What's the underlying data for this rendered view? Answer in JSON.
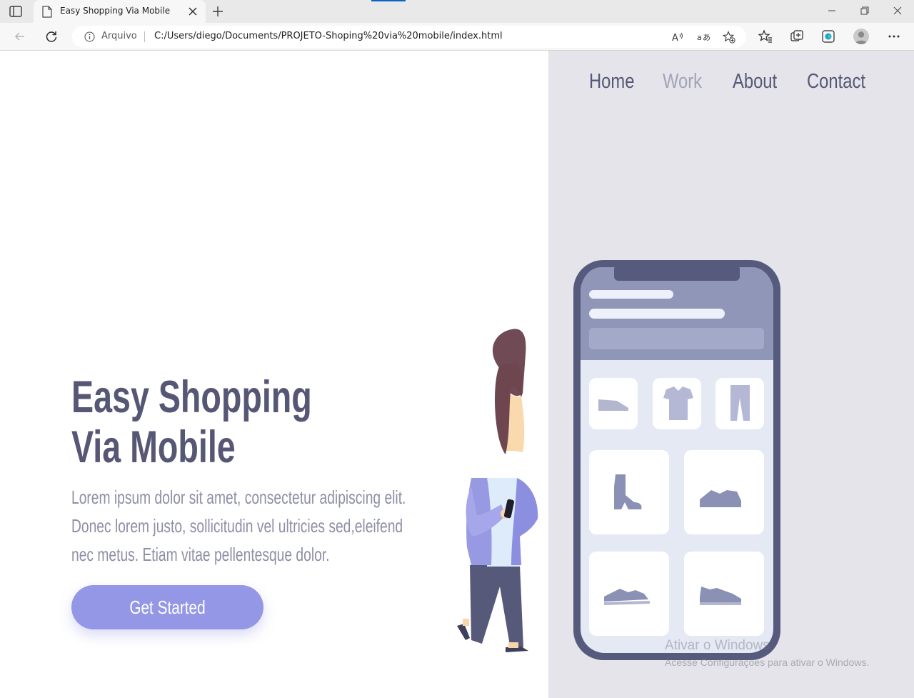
{
  "browser": {
    "tab_title": "Easy Shopping Via Mobile",
    "site_info": "Arquivo",
    "url": "C:/Users/diego/Documents/PROJETO-Shoping%20via%20mobile/index.html",
    "accent_color": "#0a64c4"
  },
  "nav": {
    "items": [
      {
        "label": "Home",
        "state": "normal"
      },
      {
        "label": "Work",
        "state": "muted"
      },
      {
        "label": "About",
        "state": "normal"
      },
      {
        "label": "Contact",
        "state": "normal"
      }
    ]
  },
  "hero": {
    "title_line1": "Easy Shopping",
    "title_line2": "Via Mobile",
    "description": "Lorem ipsum dolor sit amet, consectetur adipiscing elit. Donec lorem justo, sollicitudin vel ultricies sed,eleifend nec metus. Etiam vitae pellentesque dolor.",
    "cta_label": "Get Started"
  },
  "illustration": {
    "icons": [
      "sneaker-icon",
      "tshirt-icon",
      "pants-icon",
      "boot-icon",
      "shoe-icon",
      "sneaker-icon",
      "sneaker-icon"
    ]
  },
  "watermark": {
    "line1": "Ativar o Windows",
    "line2": "Acesse Configurações para ativar o Windows."
  },
  "colors": {
    "primary_text": "#565775",
    "muted_text": "#8e8fa6",
    "button": "#9497e6",
    "panel": "#e4e4ea",
    "phone_frame": "#565a7c"
  }
}
